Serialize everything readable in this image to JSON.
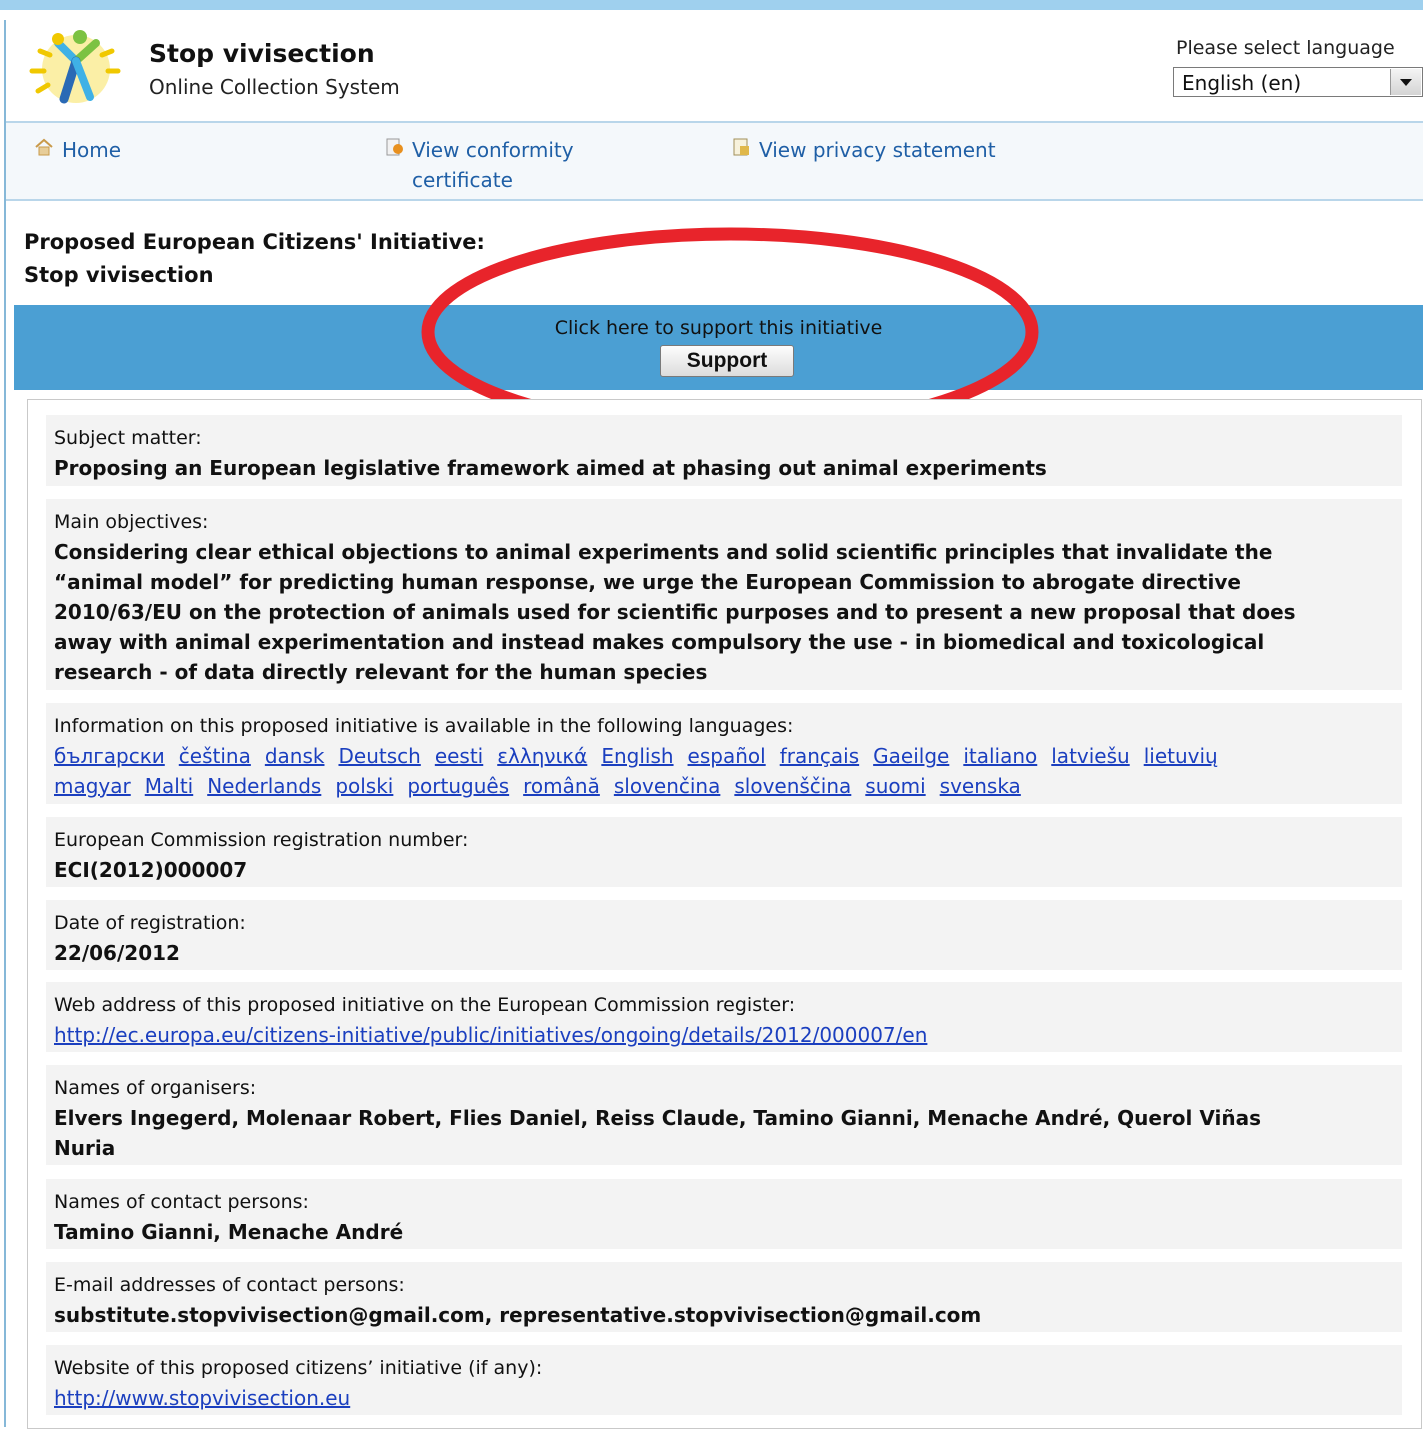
{
  "header": {
    "title": "Stop vivisection",
    "subtitle": "Online Collection System",
    "language_label": "Please select language",
    "language_value": "English (en)"
  },
  "nav": {
    "home": "Home",
    "conformity_line1": "View conformity",
    "conformity_line2": "certificate",
    "privacy": "View privacy statement"
  },
  "initiative": {
    "label": "Proposed European Citizens' Initiative:",
    "name": "Stop vivisection"
  },
  "support": {
    "prompt": "Click here to support this initiative",
    "button": "Support"
  },
  "details": {
    "subject_label": "Subject matter:",
    "subject_value": "Proposing an European legislative framework aimed at phasing out animal experiments",
    "objectives_label": "Main objectives:",
    "objectives_lines": [
      "Considering clear ethical objections to animal experiments and solid scientific principles that invalidate the",
      "“animal model” for predicting human response, we urge the European Commission to abrogate directive",
      "2010/63/EU on the protection of animals used for scientific purposes and to present a new proposal that does",
      "away with animal experimentation and instead makes compulsory the use - in biomedical and toxicological",
      "research - of data directly relevant for the human species"
    ],
    "languages_label": "Information on this proposed initiative is available in the following languages:",
    "languages_row1": [
      "български",
      "čeština",
      "dansk",
      "Deutsch",
      "eesti",
      "ελληνικά",
      "English",
      "español",
      "français",
      "Gaeilge",
      "italiano",
      "latviešu",
      "lietuvių"
    ],
    "languages_row2": [
      "magyar",
      "Malti",
      "Nederlands",
      "polski",
      "português",
      "română",
      "slovenčina",
      "slovenščina",
      "suomi",
      "svenska"
    ],
    "regnum_label": "European Commission registration number:",
    "regnum_value": "ECI(2012)000007",
    "date_label": "Date of registration:",
    "date_value": "22/06/2012",
    "webaddr_label": "Web address of this proposed initiative on the European Commission register:",
    "webaddr_value": "http://ec.europa.eu/citizens-initiative/public/initiatives/ongoing/details/2012/000007/en",
    "organisers_label": "Names of organisers:",
    "organisers_line1": "Elvers Ingegerd, Molenaar Robert, Flies Daniel, Reiss Claude, Tamino Gianni, Menache André, Querol Viñas",
    "organisers_line2": "Nuria",
    "contacts_label": "Names of contact persons:",
    "contacts_value": "Tamino Gianni, Menache André",
    "emails_label": "E-mail addresses of contact persons:",
    "emails_value": "substitute.stopvivisection@gmail.com, representative.stopvivisection@gmail.com",
    "website_label": "Website of this proposed citizens’ initiative (if any):",
    "website_value": "http://www.stopvivisection.eu"
  },
  "colors": {
    "support_bar": "#4b9fd3",
    "highlight_ellipse": "#e8242b",
    "link": "#1b3fbf"
  }
}
